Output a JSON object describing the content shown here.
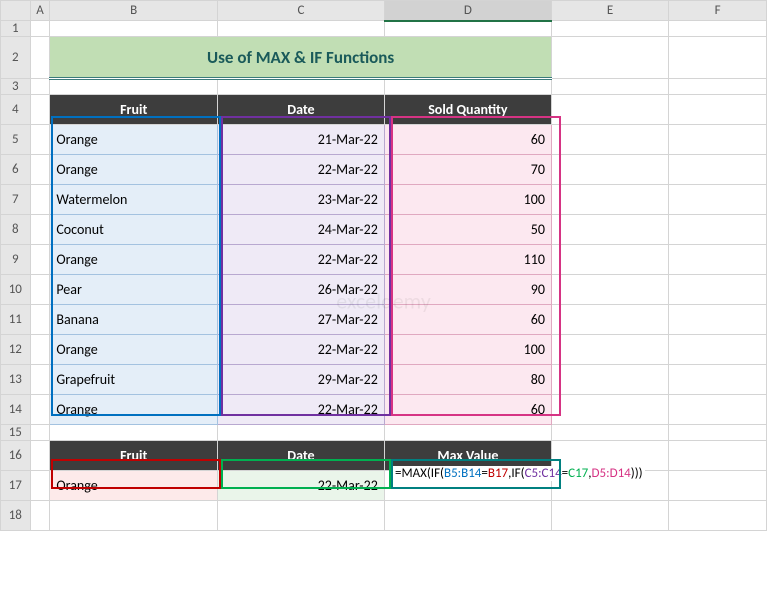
{
  "columns": [
    "A",
    "B",
    "C",
    "D",
    "E",
    "F"
  ],
  "rows": [
    "1",
    "2",
    "3",
    "4",
    "5",
    "6",
    "7",
    "8",
    "9",
    "10",
    "11",
    "12",
    "13",
    "14",
    "15",
    "16",
    "17",
    "18"
  ],
  "title": "Use of MAX & IF Functions",
  "headers": {
    "fruit": "Fruit",
    "date": "Date",
    "qty": "Sold Quantity"
  },
  "data": [
    {
      "fruit": "Orange",
      "date": "21-Mar-22",
      "qty": "60"
    },
    {
      "fruit": "Orange",
      "date": "22-Mar-22",
      "qty": "70"
    },
    {
      "fruit": "Watermelon",
      "date": "23-Mar-22",
      "qty": "100"
    },
    {
      "fruit": "Coconut",
      "date": "24-Mar-22",
      "qty": "50"
    },
    {
      "fruit": "Orange",
      "date": "22-Mar-22",
      "qty": "110"
    },
    {
      "fruit": "Pear",
      "date": "26-Mar-22",
      "qty": "90"
    },
    {
      "fruit": "Banana",
      "date": "27-Mar-22",
      "qty": "60"
    },
    {
      "fruit": "Orange",
      "date": "22-Mar-22",
      "qty": "100"
    },
    {
      "fruit": "Grapefruit",
      "date": "29-Mar-22",
      "qty": "80"
    },
    {
      "fruit": "Orange",
      "date": "22-Mar-22",
      "qty": "60"
    }
  ],
  "lookup_headers": {
    "fruit": "Fruit",
    "date": "Date",
    "max": "Max Value"
  },
  "lookup": {
    "fruit": "Orange",
    "date": "22-Mar-22"
  },
  "formula": {
    "prefix": "=MAX(IF(",
    "r1": "B5:B14",
    "eq1": "=",
    "r2": "B17",
    "sep1": ",IF(",
    "r3": "C5:C14",
    "eq2": "=",
    "r4": "C17",
    "sep2": ",",
    "r5": "D5:D14",
    "suffix": ")))"
  },
  "watermark": "exceldemy",
  "chart_data": {
    "type": "table",
    "title": "Use of MAX & IF Functions",
    "columns": [
      "Fruit",
      "Date",
      "Sold Quantity"
    ],
    "rows": [
      [
        "Orange",
        "21-Mar-22",
        60
      ],
      [
        "Orange",
        "22-Mar-22",
        70
      ],
      [
        "Watermelon",
        "23-Mar-22",
        100
      ],
      [
        "Coconut",
        "24-Mar-22",
        50
      ],
      [
        "Orange",
        "22-Mar-22",
        110
      ],
      [
        "Pear",
        "26-Mar-22",
        90
      ],
      [
        "Banana",
        "27-Mar-22",
        60
      ],
      [
        "Orange",
        "22-Mar-22",
        100
      ],
      [
        "Grapefruit",
        "29-Mar-22",
        80
      ],
      [
        "Orange",
        "22-Mar-22",
        60
      ]
    ],
    "lookup": {
      "Fruit": "Orange",
      "Date": "22-Mar-22",
      "Max Value": "=MAX(IF(B5:B14=B17,IF(C5:C14=C17,D5:D14)))"
    }
  }
}
